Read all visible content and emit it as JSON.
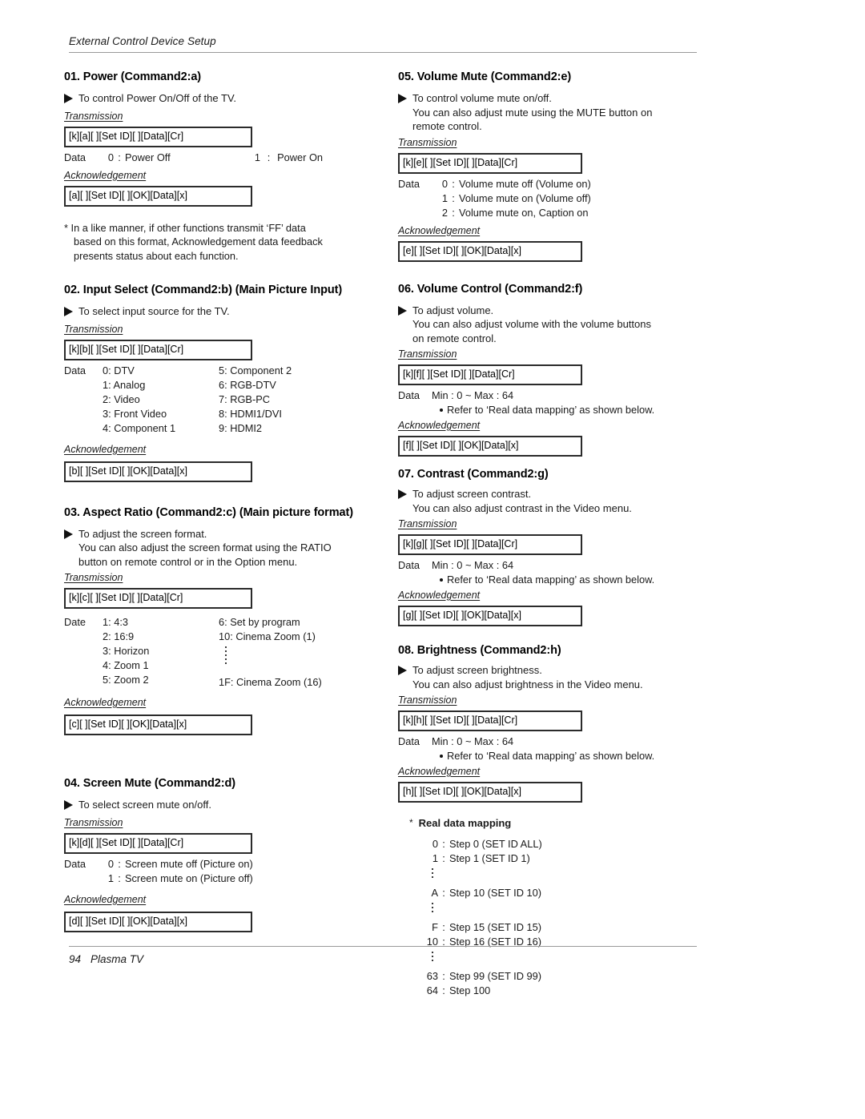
{
  "header": {
    "title": "External Control Device Setup"
  },
  "footer": {
    "page_number": "94",
    "product": "Plasma TV"
  },
  "labels": {
    "transmission": "Transmission",
    "acknowledgement": "Acknowledgement",
    "data": "Data",
    "date": "Date"
  },
  "sections": {
    "s01": {
      "title": "01. Power (Command2:a)",
      "desc": [
        "To control Power On/Off of the TV."
      ],
      "transmission_code": "[k][a][  ][Set ID][  ][Data][Cr]",
      "data_left_key": "Data",
      "data_left_num": "0",
      "data_left_sep": ":",
      "data_left_val": "Power Off",
      "data_right_num": "1",
      "data_right_sep": ":",
      "data_right_val": "Power On",
      "ack_code": "[a][  ][Set ID][  ][OK][Data][x]",
      "note": [
        "* In a like manner, if other functions transmit ‘FF’ data",
        "based on this format, Acknowledgement data feedback",
        "presents status about each function."
      ]
    },
    "s02": {
      "title": "02. Input Select (Command2:b) (Main Picture Input)",
      "desc": [
        "To select input source for the TV."
      ],
      "transmission_code": "[k][b][  ][Set ID][  ][Data][Cr]",
      "data_lead": "Data",
      "data_col_a": [
        "0: DTV",
        "1: Analog",
        "2: Video",
        "3: Front Video",
        "4: Component 1"
      ],
      "data_col_b": [
        "5: Component 2",
        "6: RGB-DTV",
        "7: RGB-PC",
        "8: HDMI1/DVI",
        "9: HDMI2"
      ],
      "ack_code": "[b][  ][Set ID][  ][OK][Data][x]"
    },
    "s03": {
      "title": "03. Aspect Ratio (Command2:c) (Main picture format)",
      "desc": [
        "To adjust the screen format.",
        "You can also adjust the screen format using the RATIO",
        "button on remote control or in the Option menu."
      ],
      "transmission_code": "[k][c][  ][Set ID][  ][Data][Cr]",
      "data_lead": "Date",
      "data_col_a": [
        "1: 4:3",
        "2: 16:9",
        "3: Horizon",
        "4: Zoom 1",
        "5: Zoom 2"
      ],
      "data_col_b_top": [
        "6: Set by program",
        "10: Cinema Zoom (1)"
      ],
      "data_col_b_bottom": [
        "1F: Cinema Zoom (16)"
      ],
      "ack_code": "[c][  ][Set ID][  ][OK][Data][x]"
    },
    "s04": {
      "title": "04. Screen Mute (Command2:d)",
      "desc": [
        "To select screen mute on/off."
      ],
      "transmission_code": "[k][d][  ][Set ID][  ][Data][Cr]",
      "data_rows": [
        {
          "key": "Data",
          "num": "0",
          "sep": ":",
          "val": "Screen mute off (Picture on)"
        },
        {
          "key": "",
          "num": "1",
          "sep": ":",
          "val": "Screen mute on (Picture off)"
        }
      ],
      "ack_code": "[d][  ][Set ID][  ][OK][Data][x]"
    },
    "s05": {
      "title": "05. Volume Mute (Command2:e)",
      "desc": [
        "To control volume mute on/off.",
        "You can also adjust mute using the MUTE button on",
        "remote control."
      ],
      "transmission_code": "[k][e][  ][Set ID][  ][Data][Cr]",
      "data_rows": [
        {
          "key": "Data",
          "num": "0",
          "sep": ":",
          "val": "Volume mute off (Volume on)"
        },
        {
          "key": "",
          "num": "1",
          "sep": ":",
          "val": "Volume mute on (Volume off)"
        },
        {
          "key": "",
          "num": "2",
          "sep": ":",
          "val": "Volume mute on, Caption on"
        }
      ],
      "ack_code": "[e][  ][Set ID][  ][OK][Data][x]"
    },
    "s06": {
      "title": "06. Volume Control (Command2:f)",
      "desc": [
        "To adjust volume.",
        "You can also adjust volume with the volume buttons",
        "on remote control."
      ],
      "transmission_code": "[k][f][  ][Set ID][  ][Data][Cr]",
      "data_range_key": "Data",
      "data_range_val": "Min : 0 ~ Max : 64",
      "data_bullet": "Refer to ‘Real data mapping’ as shown below.",
      "ack_code": "[f][  ][Set ID][  ][OK][Data][x]"
    },
    "s07": {
      "title": "07. Contrast (Command2:g)",
      "desc": [
        "To adjust screen contrast.",
        "You can also adjust contrast in the Video menu."
      ],
      "transmission_code": "[k][g][  ][Set ID][  ][Data][Cr]",
      "data_range_key": "Data",
      "data_range_val": "Min : 0 ~ Max : 64",
      "data_bullet": "Refer to ‘Real data mapping’ as shown below.",
      "ack_code": "[g][  ][Set ID][  ][OK][Data][x]"
    },
    "s08": {
      "title": "08. Brightness (Command2:h)",
      "desc": [
        "To adjust screen brightness.",
        "You can also adjust brightness in the Video menu."
      ],
      "transmission_code": "[k][h][  ][Set ID][  ][Data][Cr]",
      "data_range_key": "Data",
      "data_range_val": "Min : 0 ~ Max : 64",
      "data_bullet": "Refer to ‘Real data mapping’ as shown below.",
      "ack_code": "[h][  ][Set ID][  ][OK][Data][x]"
    }
  },
  "real_data_mapping": {
    "star": "*",
    "title": "Real data mapping",
    "rows": [
      {
        "code": "0",
        "sep": ":",
        "val": "Step 0  (SET ID ALL)"
      },
      {
        "code": "1",
        "sep": ":",
        "val": "Step 1  (SET ID 1)"
      },
      {
        "code": "",
        "sep": "",
        "val": "",
        "dots": true
      },
      {
        "code": "A",
        "sep": ":",
        "val": "Step 10 (SET ID 10)"
      },
      {
        "code": "",
        "sep": "",
        "val": "",
        "dots": true
      },
      {
        "code": "F",
        "sep": ":",
        "val": "Step 15 (SET ID 15)"
      },
      {
        "code": "10",
        "sep": ":",
        "val": "Step 16 (SET ID 16)"
      },
      {
        "code": "",
        "sep": "",
        "val": "",
        "dots": true
      },
      {
        "code": "63",
        "sep": ":",
        "val": "Step 99 (SET ID 99)"
      },
      {
        "code": "64",
        "sep": ":",
        "val": "Step 100"
      }
    ]
  }
}
